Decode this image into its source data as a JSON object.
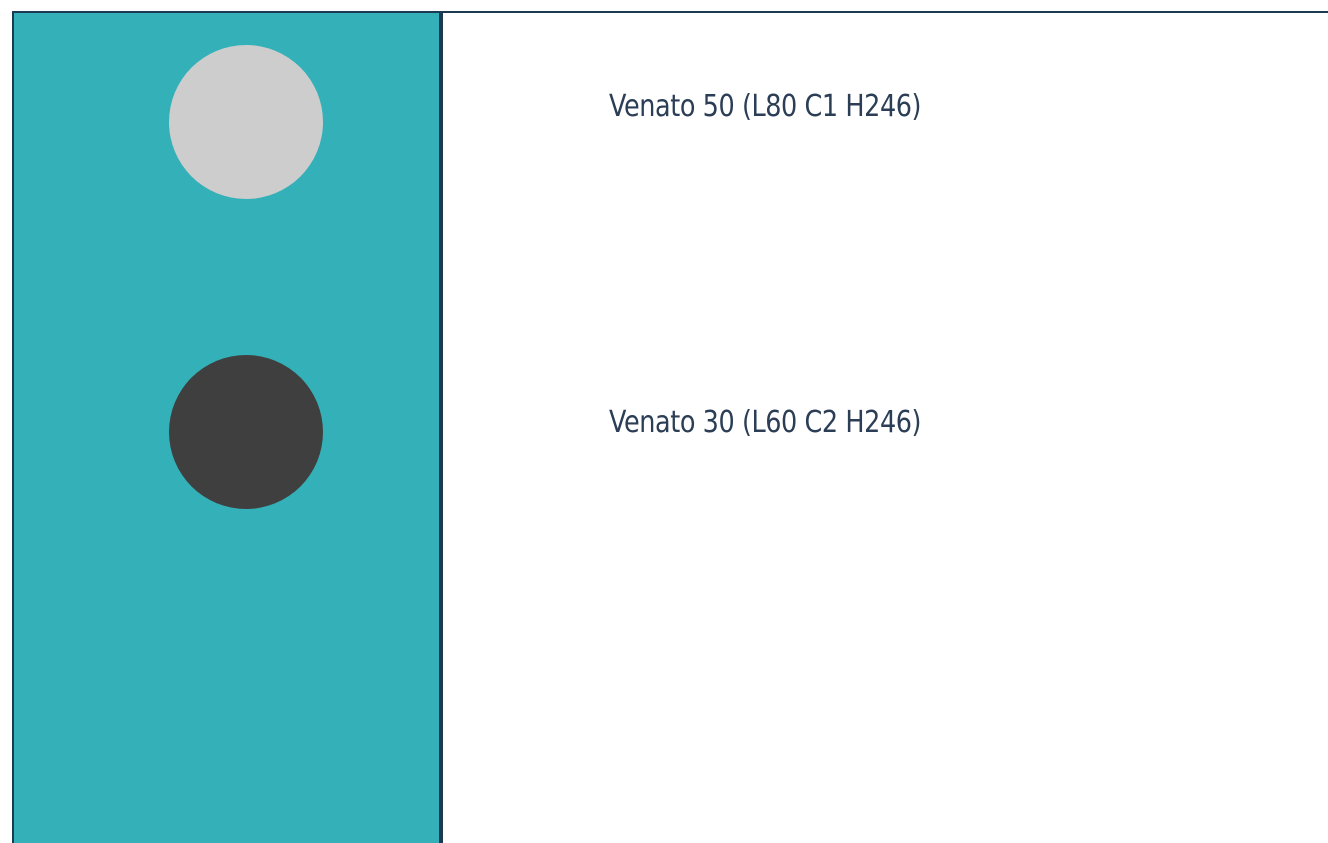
{
  "swatches": [
    {
      "label": "Venato 50 (L80 C1 H246)",
      "color": "#cdcdcd"
    },
    {
      "label": "Venato 30 (L60 C2 H246)",
      "color": "#3f3f3f"
    }
  ],
  "colors": {
    "panel": "#34b0b8",
    "border": "#1c3a52",
    "text": "#2b3e55",
    "background": "#ffffff"
  }
}
